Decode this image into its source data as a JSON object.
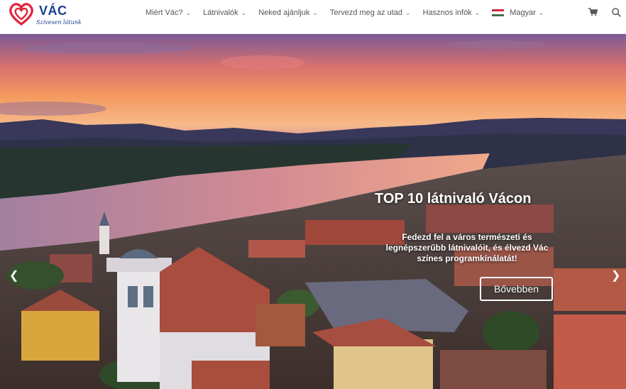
{
  "colors": {
    "brand_red": "#e0243c",
    "brand_blue": "#1b3f8f",
    "nav_text": "#555555"
  },
  "logo": {
    "name": "VÁC",
    "tagline": "Szívesen látunk"
  },
  "nav": {
    "items": [
      {
        "label": "Miért Vác?"
      },
      {
        "label": "Látnivalók"
      },
      {
        "label": "Neked ajánljuk"
      },
      {
        "label": "Tervezd meg az utad"
      },
      {
        "label": "Hasznos infók"
      }
    ],
    "language": {
      "label": "Magyar",
      "flag": "hungary-flag-icon"
    },
    "icons": [
      "cart-icon",
      "search-icon"
    ]
  },
  "hero": {
    "title": "TOP 10 látnivaló Vácon",
    "description": "Fedezd fel a város természeti és legnépszerűbb látnivalóit, és élvezd Vác színes programkínálatát!",
    "button_label": "Bővebben",
    "prev_icon": "chevron-left-icon",
    "next_icon": "chevron-right-icon"
  }
}
